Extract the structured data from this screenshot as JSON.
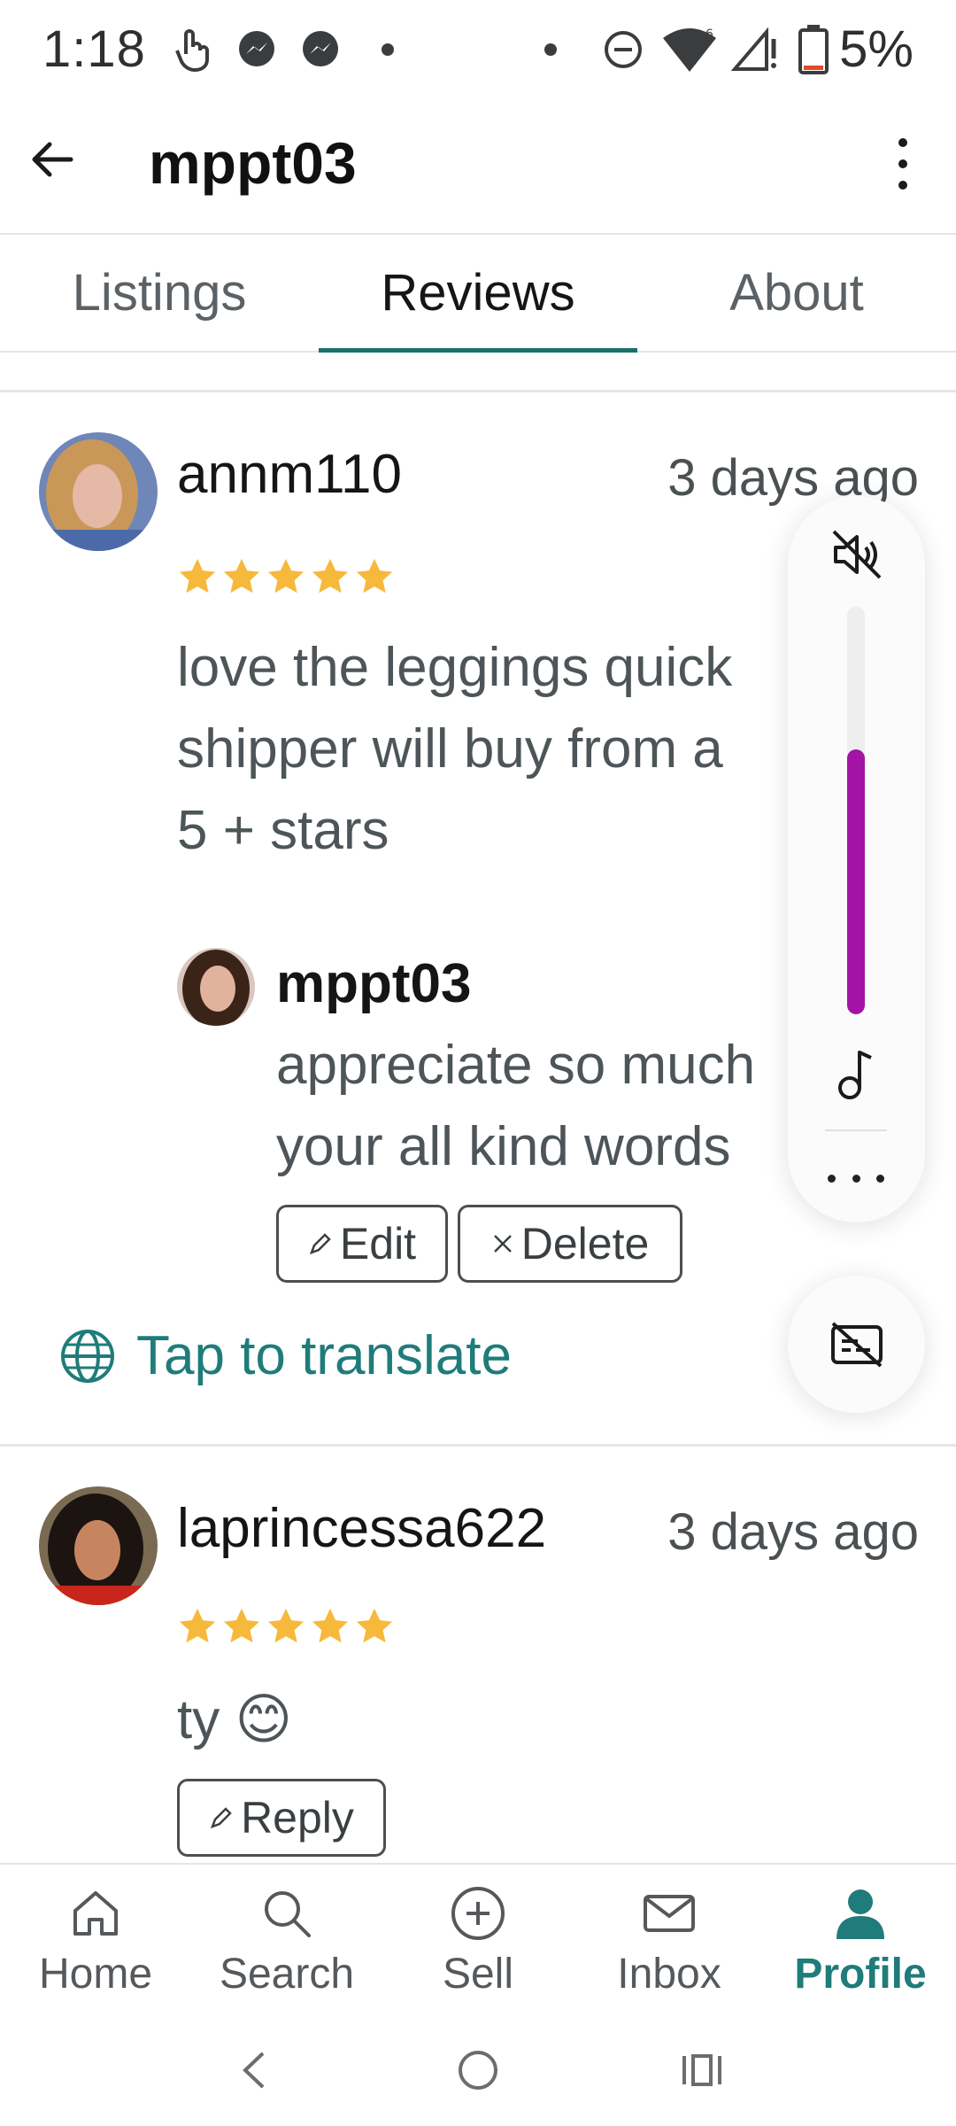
{
  "status_bar": {
    "time": "1:18",
    "battery": "5%",
    "icons": [
      "hand-pointer-icon",
      "messenger-icon",
      "messenger-icon",
      "dot-icon",
      "dot-icon",
      "dnd-icon",
      "wifi-icon",
      "signal-icon",
      "battery-icon"
    ]
  },
  "header": {
    "title": "mppt03",
    "back_icon": "arrow-left-icon",
    "menu_icon": "kebab-menu-icon"
  },
  "tabs": [
    {
      "label": "Listings",
      "active": false
    },
    {
      "label": "Reviews",
      "active": true
    },
    {
      "label": "About",
      "active": false
    }
  ],
  "reviews": [
    {
      "reviewer": "annm110",
      "date": "3 days ago",
      "rating": 5,
      "text": "love the leggings quick\nshipper will buy from a\n5 + stars",
      "reply": {
        "name": "mppt03",
        "text": "appreciate so much\nyour all kind words",
        "edit_label": "Edit",
        "delete_label": "Delete"
      },
      "translate_label": "Tap to translate"
    },
    {
      "reviewer": "laprincessa622",
      "date": "3 days ago",
      "rating": 5,
      "text": "ty 😊",
      "reply_label": "Reply"
    }
  ],
  "volume_overlay": {
    "level": 0.65,
    "fill_color": "#a313a5",
    "mute_icon": "speaker-muted-icon",
    "music_icon": "music-note-icon",
    "more_icon": "more-horizontal-icon",
    "captions_icon": "captions-off-icon"
  },
  "bottom_nav": [
    {
      "label": "Home",
      "icon": "home-icon",
      "active": false
    },
    {
      "label": "Search",
      "icon": "search-icon",
      "active": false
    },
    {
      "label": "Sell",
      "icon": "plus-circle-icon",
      "active": false
    },
    {
      "label": "Inbox",
      "icon": "envelope-icon",
      "active": false
    },
    {
      "label": "Profile",
      "icon": "person-icon",
      "active": true
    }
  ],
  "colors": {
    "accent": "#1f7c7a",
    "tab_underline": "#1b6f6c",
    "star": "#f6b93b"
  }
}
